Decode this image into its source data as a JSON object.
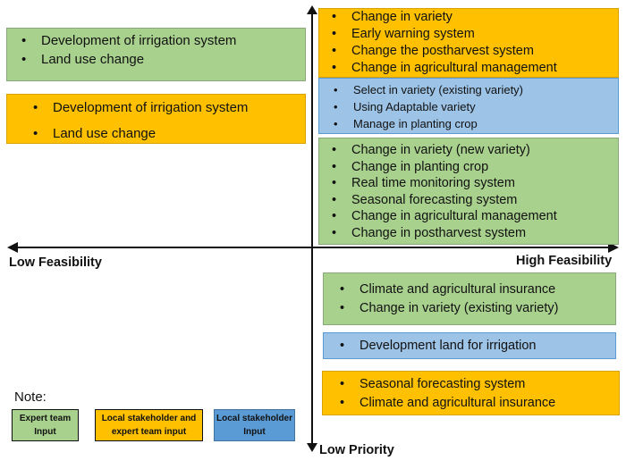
{
  "colors": {
    "expert_green": "#a9d18e",
    "combined_orange": "#ffc000",
    "local_blue": "#9dc3e6",
    "legend_blue": "#5b9bd5"
  },
  "axes": {
    "x_left_label": "Low Feasibility",
    "x_right_label": "High Feasibility",
    "y_bottom_label": "Low Priority"
  },
  "quadrants": {
    "top_left": [
      {
        "source": "expert",
        "items": [
          "Development of irrigation system",
          "Land use change"
        ]
      },
      {
        "source": "combined",
        "items": [
          "Development of irrigation system",
          "Land use change"
        ]
      }
    ],
    "top_right": [
      {
        "source": "combined",
        "items": [
          "Change in variety",
          "Early warning system",
          "Change the postharvest system",
          "Change in agricultural management"
        ]
      },
      {
        "source": "local",
        "items": [
          "Select in variety (existing variety)",
          "Using Adaptable variety",
          "Manage in planting crop"
        ]
      },
      {
        "source": "expert",
        "items": [
          "Change in variety (new variety)",
          "Change in planting crop",
          "Real time monitoring system",
          "Seasonal forecasting system",
          "Change in agricultural management",
          "Change in postharvest system"
        ]
      }
    ],
    "bottom_right": [
      {
        "source": "expert",
        "items": [
          "Climate and agricultural insurance",
          "Change in variety (existing variety)"
        ]
      },
      {
        "source": "local",
        "items": [
          "Development land for irrigation"
        ]
      },
      {
        "source": "combined",
        "items": [
          "Seasonal forecasting system",
          "Climate and agricultural insurance"
        ]
      }
    ]
  },
  "legend": {
    "title": "Note:",
    "entries": [
      {
        "line1": "Expert team",
        "line2": "Input"
      },
      {
        "line1": "Local stakeholder and",
        "line2": "expert team input"
      },
      {
        "line1": "Local stakeholder",
        "line2": "Input"
      }
    ]
  }
}
